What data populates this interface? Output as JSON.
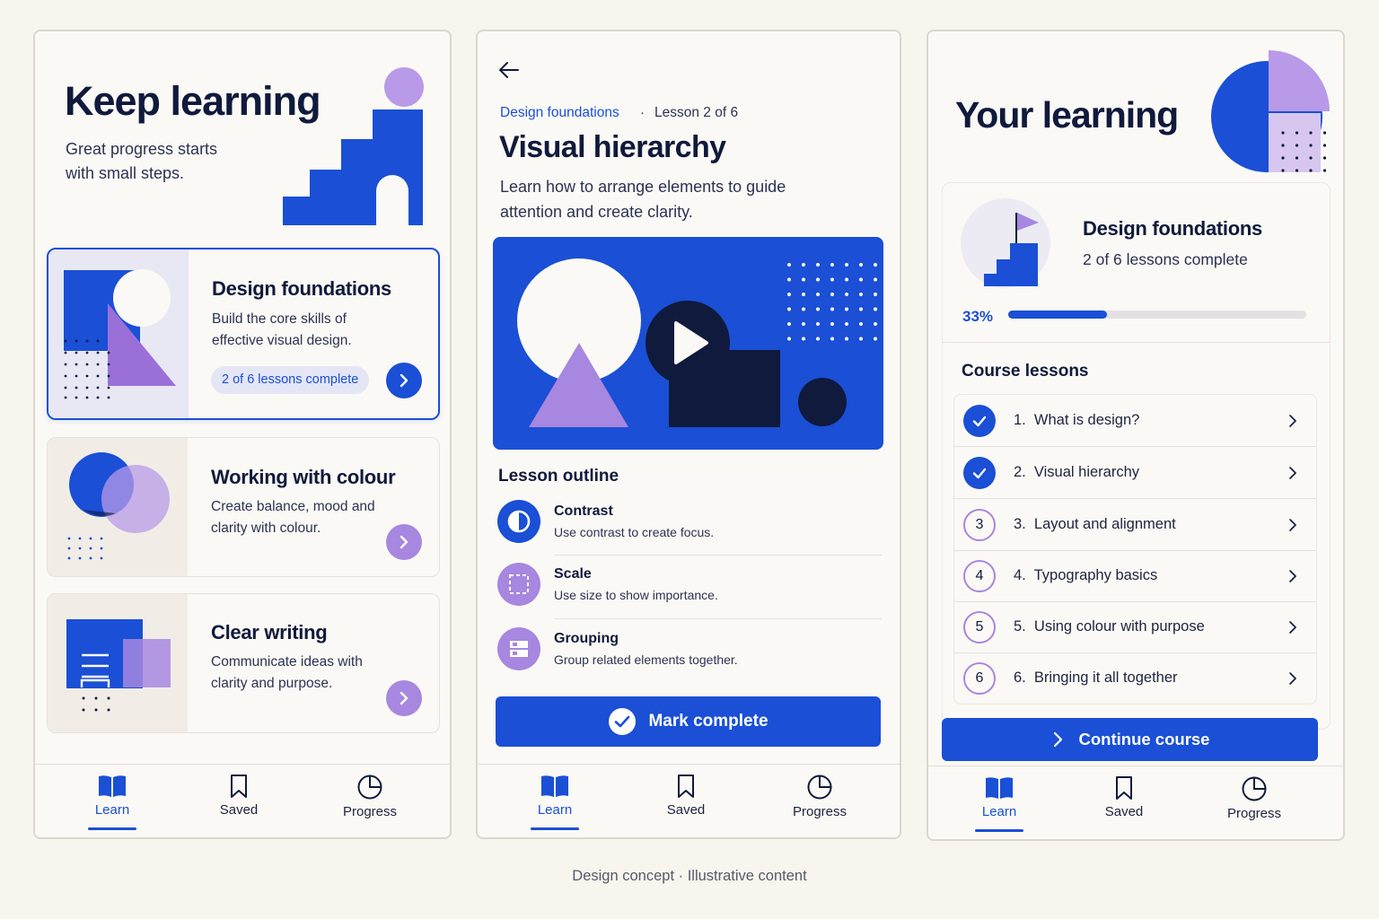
{
  "screen1": {
    "title": "Keep learning",
    "subtitle": "Great progress starts with small steps.",
    "courses": [
      {
        "title": "Design foundations",
        "description": "Build the core skills of effective visual design.",
        "progress": "2 of 6 lessons complete",
        "progress_fraction": 0.33,
        "icon": "chevron-right-icon"
      },
      {
        "title": "Working with colour",
        "description": "Create balance, mood and clarity with colour.",
        "icon": "chevron-right-icon"
      },
      {
        "title": "Clear writing",
        "description": "Communicate ideas with clarity and purpose.",
        "icon": "chevron-right-icon"
      }
    ]
  },
  "screen2": {
    "breadcrumb_course": "Design foundations",
    "breadcrumb_separator": "·",
    "breadcrumb_lesson": "Lesson 2 of 6",
    "title": "Visual hierarchy",
    "description": "Learn how to arrange elements to guide attention and create clarity.",
    "outline_title": "Lesson outline",
    "outline": [
      {
        "name": "Contrast",
        "description": "Use contrast to create focus.",
        "icon": "contrast-icon"
      },
      {
        "name": "Scale",
        "description": "Use size to show importance.",
        "icon": "scale-icon"
      },
      {
        "name": "Grouping",
        "description": "Group related elements together.",
        "icon": "grouping-icon"
      }
    ],
    "mark_complete": "Mark complete"
  },
  "screen3": {
    "title": "Your learning",
    "course_title": "Design foundations",
    "course_progress": "2 of 6 lessons complete",
    "percent": "33%",
    "progress_fraction": 0.33,
    "lessons_title": "Course lessons",
    "lessons": [
      {
        "number": "1",
        "label": "1.  What is design?",
        "status": "complete"
      },
      {
        "number": "2",
        "label": "2.  Visual hierarchy",
        "status": "complete"
      },
      {
        "number": "3",
        "label": "3.  Layout and alignment",
        "status": "incomplete"
      },
      {
        "number": "4",
        "label": "4.  Typography basics",
        "status": "incomplete"
      },
      {
        "number": "5",
        "label": "5.  Using colour with purpose",
        "status": "incomplete"
      },
      {
        "number": "6",
        "label": "6.  Bringing it all together",
        "status": "incomplete"
      }
    ],
    "continue": "Continue course"
  },
  "nav": {
    "learn": "Learn",
    "saved": "Saved",
    "progress": "Progress",
    "active": "Learn"
  },
  "colors": {
    "accent": "#1a4fd6",
    "purple": "#a787e0",
    "navy": "#0f1a3c",
    "background": "#f8f4ee"
  },
  "caption": "Design concept · Illustrative content"
}
